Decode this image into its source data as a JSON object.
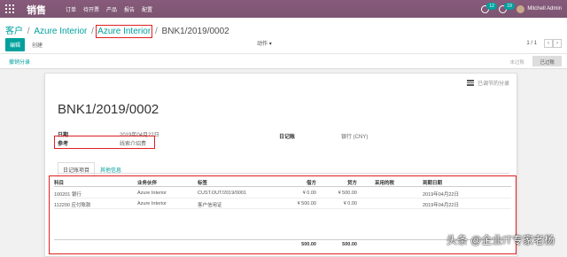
{
  "topbar": {
    "app_name": "销售",
    "menu": [
      "订单",
      "待开票",
      "产品",
      "报告",
      "配置"
    ],
    "chat_count": "12",
    "activity_count": "19",
    "user": "Mitchell Admin"
  },
  "breadcrumb": {
    "item1": "客户",
    "item2": "Azure Interior",
    "item3": "Azure Interior",
    "current": "BNK1/2019/0002",
    "sep": "/"
  },
  "toolbar": {
    "edit": "编辑",
    "create": "创建",
    "actions": "动作",
    "pager": "1 / 1"
  },
  "status": {
    "reconcile_link": "撤销分录",
    "unposted": "未过账",
    "posted": "已过账"
  },
  "sheet": {
    "follow": "已调节的分录",
    "title": "BNK1/2019/0002",
    "date_label": "日期",
    "date_value": "2019年04月22日",
    "ref_label": "参考",
    "ref_value": "线索介绍费",
    "journal_label": "日记账",
    "journal_value": "银行 (CNY)"
  },
  "tabs": [
    "日记账项目",
    "其他信息"
  ],
  "table": {
    "headers": [
      "科目",
      "业务伙伴",
      "标签",
      "借方",
      "贷方",
      "采用的税",
      "到期日期"
    ],
    "rows": [
      [
        "100201 银行",
        "Azure Interior",
        "CUST.OUT/2019/0001",
        "¥ 0.00",
        "¥ 500.00",
        "",
        "2019年04月22日"
      ],
      [
        "112200 应付账款",
        "Azure Interior",
        "客户信用证",
        "¥ 500.00",
        "¥ 0.00",
        "",
        "2019年04月22日"
      ]
    ],
    "totals": [
      "500.00",
      "500.00"
    ]
  },
  "watermark": "头条 @企业IT专家老杨",
  "colors": {
    "brand": "#875a7b",
    "accent": "#00a09d",
    "highlight": "#e02020"
  }
}
